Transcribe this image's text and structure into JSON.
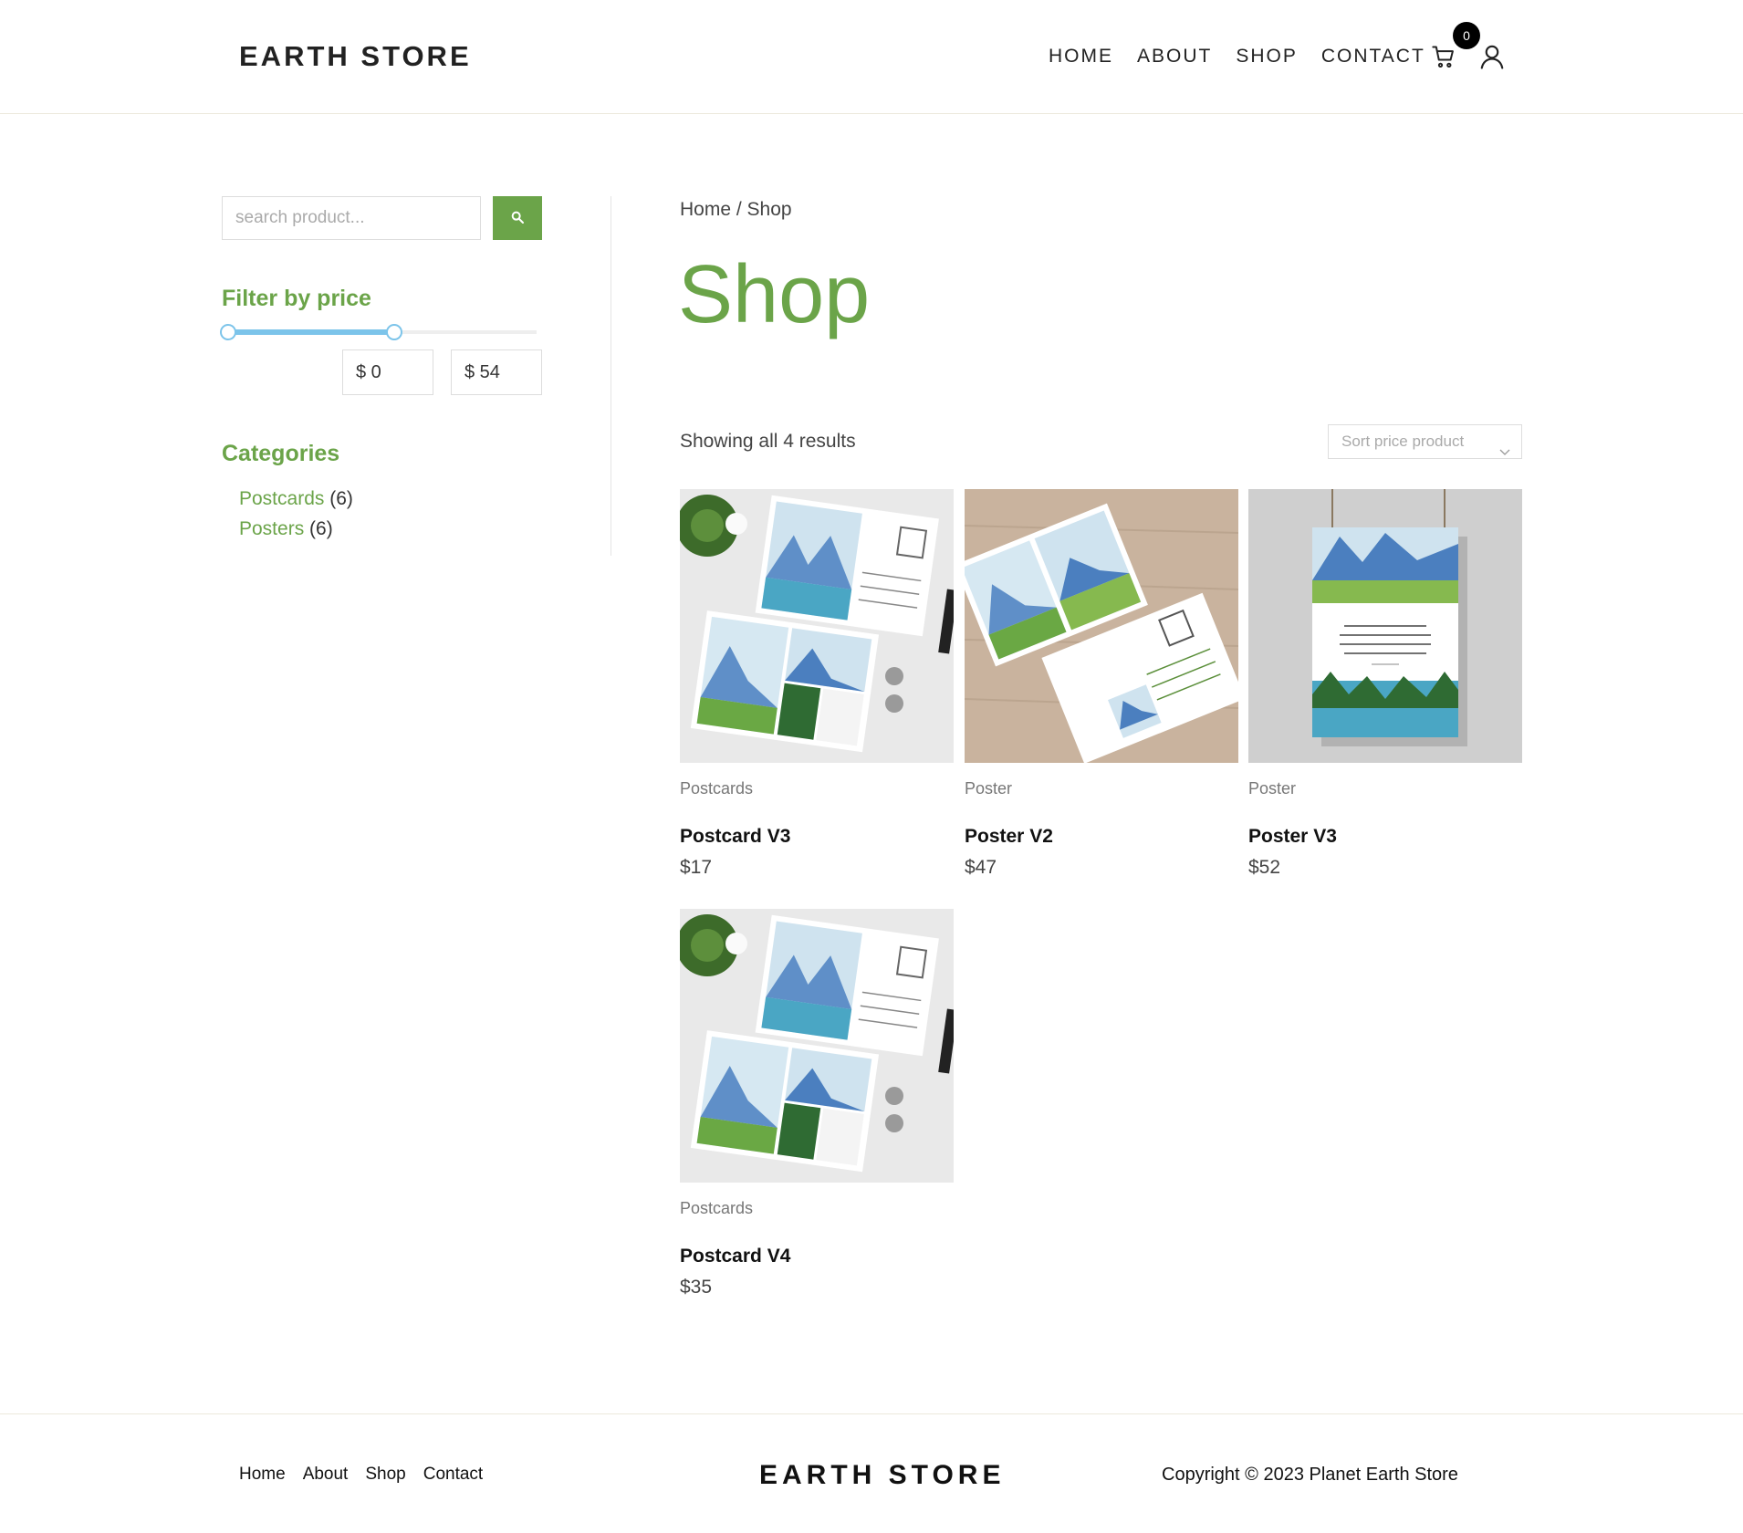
{
  "header": {
    "logo": "EARTH STORE",
    "nav": [
      "HOME",
      "ABOUT",
      "SHOP",
      "CONTACT"
    ],
    "cart_count": "0"
  },
  "sidebar": {
    "search_placeholder": "search product...",
    "filter_heading": "Filter by price",
    "price_min": "$ 0",
    "price_max": "$ 54",
    "categories_heading": "Categories",
    "categories": [
      {
        "name": "Postcards",
        "count": "(6)"
      },
      {
        "name": "Posters",
        "count": "(6)"
      }
    ]
  },
  "main": {
    "breadcrumb": "Home / Shop",
    "title": "Shop",
    "results_text": "Showing all 4 results",
    "sort_placeholder": "Sort price product",
    "products": [
      {
        "category": "Postcards",
        "name": "Postcard V3",
        "price": "$17"
      },
      {
        "category": "Poster",
        "name": "Poster V2",
        "price": "$47"
      },
      {
        "category": "Poster",
        "name": "Poster V3",
        "price": "$52"
      },
      {
        "category": "Postcards",
        "name": "Postcard V4",
        "price": "$35"
      }
    ]
  },
  "footer": {
    "links": [
      "Home",
      "About",
      "Shop",
      "Contact"
    ],
    "logo": "EARTH STORE",
    "copyright": "Copyright © 2023 Planet Earth Store"
  },
  "colors": {
    "accent": "#6ba449",
    "slider": "#7cc4ea"
  }
}
